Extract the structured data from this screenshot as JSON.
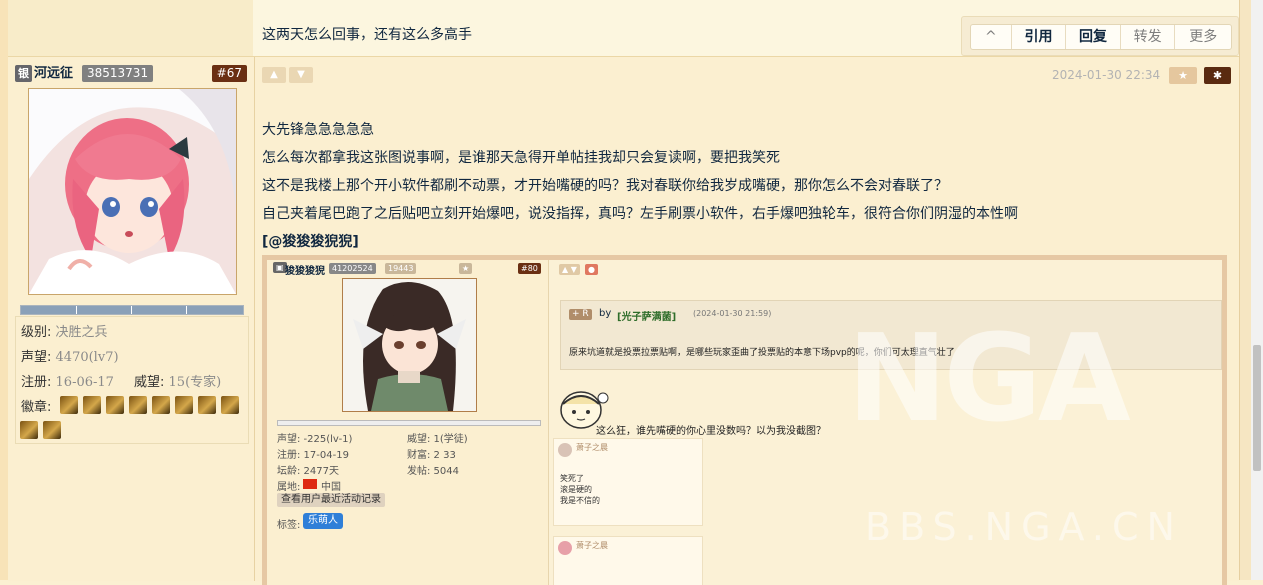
{
  "prev_post": {
    "text": "这两天怎么回事，还有这么多高手",
    "actions": [
      "^",
      "引用",
      "回复",
      "转发",
      "更多"
    ]
  },
  "post": {
    "role": "银",
    "username": "河远征",
    "uid": "38513731",
    "floor": "#67",
    "stats": {
      "level_label": "级别:",
      "level_value": "决胜之兵",
      "rep_label": "声望:",
      "rep_value": "4470(lv7)",
      "reg_label": "注册:",
      "reg_value": "16-06-17",
      "prestige_label": "威望:",
      "prestige_value": "15(专家)",
      "badge_label": "徽章:"
    },
    "badge_count": 9,
    "timestamp": "2024-01-30 22:34",
    "fav_icon": "star-icon",
    "gear_icon": "gear-icon",
    "lines": [
      "大先锋急急急急急",
      "怎么每次都拿我这张图说事啊，是谁那天急得开单帖挂我却只会复读啊，要把我笑死",
      "这不是我楼上那个开小软件都刷不动票，才开始嘴硬的吗？我对春联你给我岁成嘴硬，那你怎么不会对春联了？",
      "自己夹着尾巴跑了之后贴吧立刻开始爆吧，说没指挥，真吗？左手刷票小软件，右手爆吧独轮车，很符合你们阴湿的本性啊"
    ],
    "mention": "[@狻狻狻猊猊]",
    "accent": "#6a2f12"
  },
  "screenshot": {
    "username": "狻狻狻猊",
    "uid": "41202524",
    "stat1": "19443",
    "floor": "#80",
    "rep": "声望: -225(lv-1)",
    "prestige": "威望: 1(学徒)",
    "reg": "注册: 17-04-19",
    "wealth": "财富: 2 33",
    "age": "坛龄: 2477天",
    "posts": "发帖: 5044",
    "region_label": "属地:",
    "region": "中国",
    "recent_btn": "查看用户最近活动记录",
    "tag_label": "标签:",
    "tag": "乐萌人",
    "quote_by": "by",
    "quote_user": "[光子萨满菌]",
    "quote_time": "(2024-01-30 21:59)",
    "quote_text": "原来坑道就是投票拉票贴啊，是哪些玩家歪曲了投票贴的本意下场pvp的呢，你们可太理直气壮了",
    "comment": "这么狂，谁先嘴硬的你心里没数吗？以为我没截图？",
    "card1_name": "萧子之晨",
    "card1_lines": [
      "笑死了",
      "滚是硬的",
      "我是不信的"
    ],
    "card2_name": "萧子之晨",
    "watermark": "NGA",
    "watermark_sub": "BBS.NGA.CN"
  }
}
